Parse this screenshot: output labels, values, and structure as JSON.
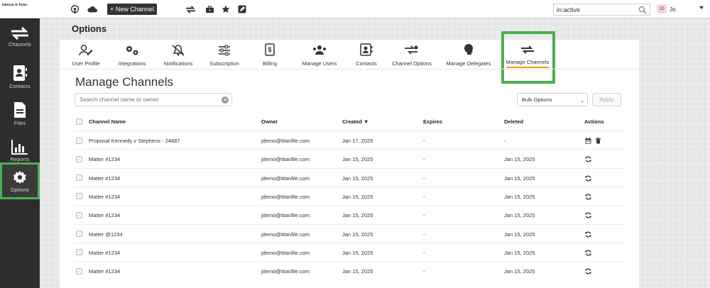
{
  "app": {
    "logo_text": "Johnson & Dano",
    "new_channel_label": "+ New Channel",
    "search_value": "in:active",
    "user_initials": "JD",
    "user_name": "Jo"
  },
  "sidebar": {
    "items": [
      {
        "label": "Channels",
        "icon": "arrows-icon"
      },
      {
        "label": "Contacts",
        "icon": "contact-book-icon"
      },
      {
        "label": "Files",
        "icon": "file-icon"
      },
      {
        "label": "Reports",
        "icon": "bar-chart-icon"
      },
      {
        "label": "Options",
        "icon": "gear-icon",
        "active": true
      }
    ]
  },
  "page": {
    "title": "Options",
    "section_title": "Manage Channels"
  },
  "tabs": [
    {
      "label": "User Profile",
      "icon": "user-edit-icon"
    },
    {
      "label": "Integrations",
      "icon": "cogs-icon"
    },
    {
      "label": "Notifications",
      "icon": "bell-slash-icon"
    },
    {
      "label": "Subscription",
      "icon": "sliders-icon"
    },
    {
      "label": "Billing",
      "icon": "invoice-icon"
    },
    {
      "label": "Manage Users",
      "icon": "users-icon"
    },
    {
      "label": "Contacts",
      "icon": "contact-card-icon"
    },
    {
      "label": "Channel Options",
      "icon": "channel-gear-icon"
    },
    {
      "label": "Manage Delegates",
      "icon": "head-icon"
    },
    {
      "label": "Manage Channels",
      "icon": "arrows-icon",
      "active": true
    }
  ],
  "controls": {
    "search_placeholder": "Search channel name or owner",
    "bulk_options_label": "Bulk Options",
    "apply_label": "Apply"
  },
  "table": {
    "columns": [
      "Channel Name",
      "Owner",
      "Created ▼",
      "Expires",
      "Deleted",
      "Actions"
    ],
    "rows": [
      {
        "name": "Proposal Kennedy v Stephens - 24887",
        "owner": "jdemo@titanfile.com",
        "created": "Jan 17, 2025",
        "expires": "-",
        "deleted": "-",
        "actions": [
          "calendar-icon",
          "trash-icon"
        ]
      },
      {
        "name": "Matter #1234",
        "owner": "jdemo@titanfile.com",
        "created": "Jan 15, 2025",
        "expires": "-",
        "deleted": "Jan 15, 2025",
        "actions": [
          "restore-icon"
        ]
      },
      {
        "name": "Matter #1234",
        "owner": "jdemo@titanfile.com",
        "created": "Jan 15, 2025",
        "expires": "-",
        "deleted": "Jan 15, 2025",
        "actions": [
          "restore-icon"
        ]
      },
      {
        "name": "Matter #1234",
        "owner": "jdemo@titanfile.com",
        "created": "Jan 15, 2025",
        "expires": "-",
        "deleted": "Jan 15, 2025",
        "actions": [
          "restore-icon"
        ]
      },
      {
        "name": "Matter #1234",
        "owner": "jdemo@titanfile.com",
        "created": "Jan 15, 2025",
        "expires": "-",
        "deleted": "Jan 15, 2025",
        "actions": [
          "restore-icon"
        ]
      },
      {
        "name": "Matter @1234",
        "owner": "jdemo@titanfile.com",
        "created": "Jan 15, 2025",
        "expires": "-",
        "deleted": "Jan 15, 2025",
        "actions": [
          "restore-icon"
        ]
      },
      {
        "name": "Matter #1234",
        "owner": "jdemo@titanfile.com",
        "created": "Jan 15, 2025",
        "expires": "-",
        "deleted": "Jan 15, 2025",
        "actions": [
          "restore-icon"
        ]
      },
      {
        "name": "Matter #1234",
        "owner": "jdemo@titanfile.com",
        "created": "Jan 15, 2025",
        "expires": "-",
        "deleted": "Jan 15, 2025",
        "actions": [
          "restore-icon"
        ]
      }
    ]
  },
  "colors": {
    "highlight": "#4caf50",
    "active_underline": "#ff9800",
    "sidebar_bg": "#2d2d2d"
  }
}
